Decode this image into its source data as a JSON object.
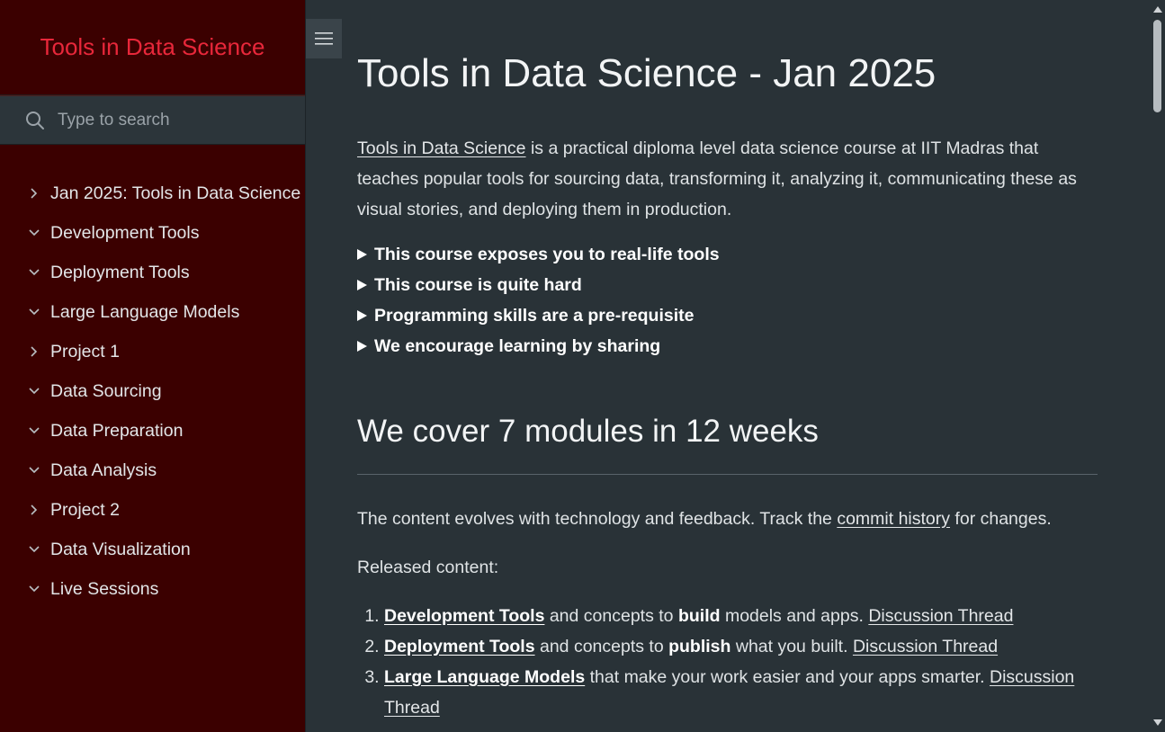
{
  "sidebar": {
    "app_title": "Tools in Data Science",
    "search_placeholder": "Type to search",
    "items": [
      {
        "label": "Jan 2025: Tools in Data Science",
        "state": "collapsed"
      },
      {
        "label": "Development Tools",
        "state": "expanded"
      },
      {
        "label": "Deployment Tools",
        "state": "expanded"
      },
      {
        "label": "Large Language Models",
        "state": "expanded"
      },
      {
        "label": "Project 1",
        "state": "collapsed"
      },
      {
        "label": "Data Sourcing",
        "state": "expanded"
      },
      {
        "label": "Data Preparation",
        "state": "expanded"
      },
      {
        "label": "Data Analysis",
        "state": "expanded"
      },
      {
        "label": "Project 2",
        "state": "collapsed"
      },
      {
        "label": "Data Visualization",
        "state": "expanded"
      },
      {
        "label": "Live Sessions",
        "state": "expanded"
      }
    ]
  },
  "main": {
    "title": "Tools in Data Science - Jan 2025",
    "intro": {
      "link": "Tools in Data Science",
      "rest": " is a practical diploma level data science course at IIT Madras that teaches popular tools for sourcing data, transforming it, analyzing it, communicating these as visual stories, and deploying them in production."
    },
    "details": [
      "This course exposes you to real-life tools",
      "This course is quite hard",
      "Programming skills are a pre-requisite",
      "We encourage learning by sharing"
    ],
    "modules_heading": "We cover 7 modules in 12 weeks",
    "evolves": {
      "before": "The content evolves with technology and feedback. Track the ",
      "link": "commit history",
      "after": " for changes."
    },
    "released_label": "Released content:",
    "released": [
      {
        "link": "Development Tools",
        "pre": " and concepts to ",
        "bold": "build",
        "post": " models and apps. ",
        "thread": "Discussion Thread"
      },
      {
        "link": "Deployment Tools",
        "pre": " and concepts to ",
        "bold": "publish",
        "post": " what you built. ",
        "thread": "Discussion Thread"
      },
      {
        "link": "Large Language Models",
        "pre": " that make your work easier and your apps smarter. ",
        "bold": "",
        "post": "",
        "thread": "Discussion Thread"
      }
    ]
  },
  "colors": {
    "sidebar_bg": "#3b0000",
    "title_accent": "#e8273a",
    "content_bg": "#293237"
  },
  "icons": [
    "search-icon",
    "chevron-right-icon",
    "chevron-down-icon",
    "hamburger-menu-icon"
  ]
}
